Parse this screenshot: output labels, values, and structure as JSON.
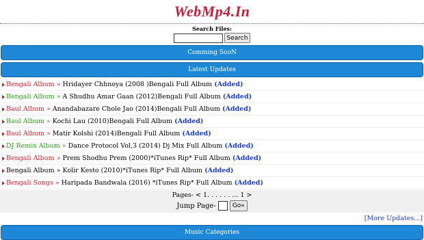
{
  "site": {
    "logo": "WebMp4.In"
  },
  "search": {
    "title": "Search Files:",
    "button_label": "Search",
    "value": ""
  },
  "bars": {
    "coming_soon": "Comming SooN",
    "latest_updates": "Latest Updates",
    "music_categories": "Music Categories"
  },
  "updates": [
    {
      "category": "Bengali Album",
      "category_color": "#d21e2a",
      "sep": " » ",
      "title": "Hridayer Chhnoya (2008 )Bengali Full Album",
      "added": "(Added)"
    },
    {
      "category": "Bengali Album",
      "category_color": "#2c9a1a",
      "sep": " » ",
      "title": "A Shudhu Amar Gaan (2012)Bengali Full Album",
      "added": "(Added)"
    },
    {
      "category": "Baul Album",
      "category_color": "#d21e2a",
      "sep": " » ",
      "title": "Anandabazare Chole Jao (2014)Bengali Full Album",
      "added": "(Added)"
    },
    {
      "category": "Baul Album",
      "category_color": "#2c9a1a",
      "sep": " » ",
      "title": "Kochi Lau (2010)Bengali Full Album",
      "added": "(Added)"
    },
    {
      "category": "Baul Album",
      "category_color": "#d21e2a",
      "sep": " » ",
      "title": "Matir Kolshi (2014)Bengali Full Album",
      "added": "(Added)"
    },
    {
      "category": "DJ Remix Album",
      "category_color": "#2c9a1a",
      "sep": " » ",
      "title": "Dance Protocol Vol,3 (2014) Dj Mix Full Album",
      "added": "(Added)"
    },
    {
      "category": "Bengali Album",
      "category_color": "#d21e2a",
      "sep": " » ",
      "title": "Prem Shodhu Prem (2000)*iTunes Rip* Full Album",
      "added": "(Added)"
    },
    {
      "category": "Bengali Album",
      "category_color": "#000000",
      "sep": " » ",
      "title": "Kolir Kesto (2010)*iTunes Rip* Full Album",
      "added": "(Added)"
    },
    {
      "category": "Bengali Songs",
      "category_color": "#d21e2a",
      "sep": " » ",
      "title": "Haripada Bandwala (2016) *iTunes Rip* Full Album",
      "added": "(Added)"
    }
  ],
  "pagination": {
    "pages_text": "Pages- < 1. . . . . . ... 1 >",
    "jump_label": "Jump Page-",
    "go_label": "Go»"
  },
  "more_updates": "[More Updates...]",
  "colors": {
    "bar_blue": "#1e88d6",
    "logo_red": "#c0203a",
    "added_blue": "#1a3bd6"
  }
}
